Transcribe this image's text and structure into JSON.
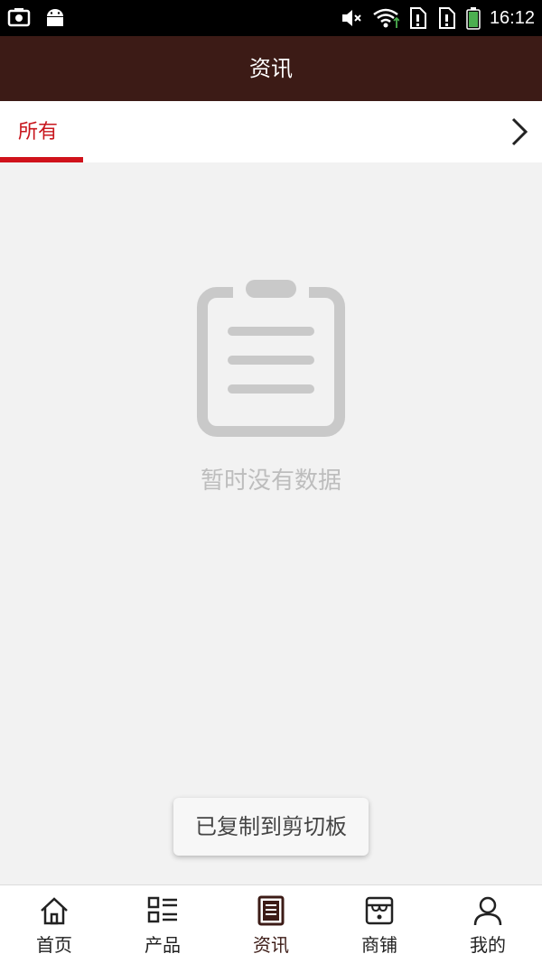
{
  "status_bar": {
    "time": "16:12",
    "icons": [
      "camera-icon",
      "android-icon",
      "volume-mute-icon",
      "wifi-icon",
      "sim1-icon",
      "sim2-icon",
      "battery-icon"
    ]
  },
  "header": {
    "title": "资讯"
  },
  "category_tabs": {
    "items": [
      {
        "label": "所有",
        "active": true
      }
    ],
    "more_icon": "chevron-right-icon"
  },
  "empty_state": {
    "icon": "clipboard-icon",
    "message": "暂时没有数据"
  },
  "toast": {
    "message": "已复制到剪切板"
  },
  "bottom_nav": {
    "items": [
      {
        "label": "首页",
        "icon": "home-icon",
        "active": false
      },
      {
        "label": "产品",
        "icon": "list-icon",
        "active": false
      },
      {
        "label": "资讯",
        "icon": "news-icon",
        "active": true
      },
      {
        "label": "商铺",
        "icon": "store-icon",
        "active": false
      },
      {
        "label": "我的",
        "icon": "user-icon",
        "active": false
      }
    ]
  },
  "colors": {
    "header_bg": "#3c1b16",
    "accent_red": "#d0121b",
    "empty_gray": "#bdbdbd"
  }
}
